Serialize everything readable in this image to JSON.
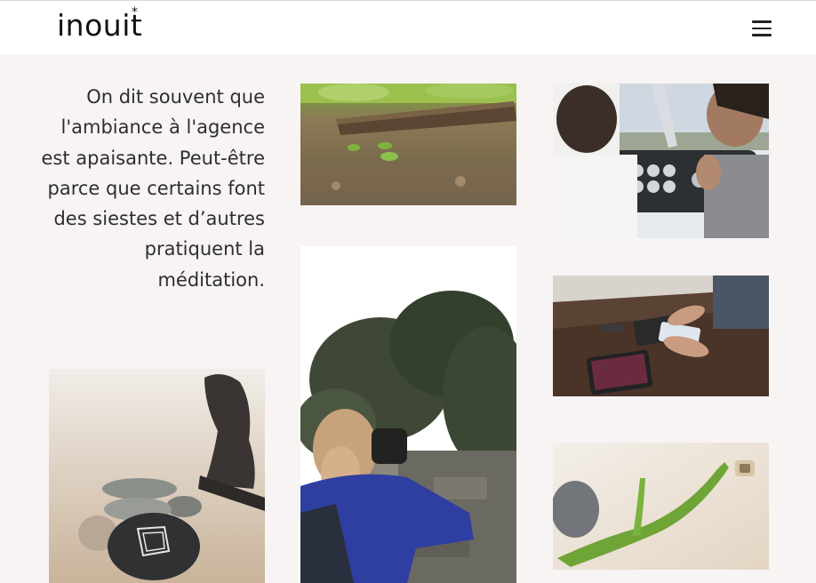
{
  "header": {
    "logo_text": "inouit",
    "logo_mark": "*",
    "menu_icon": "hamburger-menu-icon"
  },
  "intro": {
    "text": "On dit souvent que l'ambiance à l'agence est apaisante. Peut-être parce que certains font des siestes et d’autres pratiquent la méditation."
  },
  "colors": {
    "background": "#f8f4f4",
    "header": "#ffffff",
    "text": "#2e2e2e"
  },
  "gallery": [
    {
      "name": "forest-floor-photo"
    },
    {
      "name": "cockpit-photo"
    },
    {
      "name": "photographer-photo"
    },
    {
      "name": "tablet-desk-photo"
    },
    {
      "name": "meditation-stones-photo"
    },
    {
      "name": "cactus-stone-photo"
    }
  ]
}
